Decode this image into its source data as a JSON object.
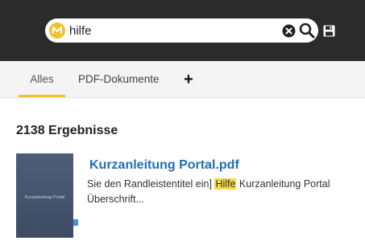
{
  "search": {
    "value": "hilfe"
  },
  "tabs": [
    {
      "label": "Alles"
    },
    {
      "label": "PDF-Dokumente"
    },
    {
      "label": "+"
    }
  ],
  "results": {
    "count_label": "2138 Ergebnisse",
    "items": [
      {
        "title": "Kurzanleitung Portal.pdf",
        "thumbnail_text": "Kurzanleitung Portal",
        "snippet_before": "Sie den Randleistentitel ein] ",
        "snippet_highlight": "Hilfe",
        "snippet_after": " Kurzanleitung Portal Überschrift..."
      }
    ]
  },
  "colors": {
    "header_bg": "#2b2b2b",
    "accent": "#f2c12e",
    "link": "#1f6fb5",
    "highlight": "#f7d948"
  },
  "icons": {
    "logo": "logo-icon",
    "clear": "clear-icon",
    "search": "search-icon",
    "save": "save-icon",
    "add": "plus-icon"
  }
}
